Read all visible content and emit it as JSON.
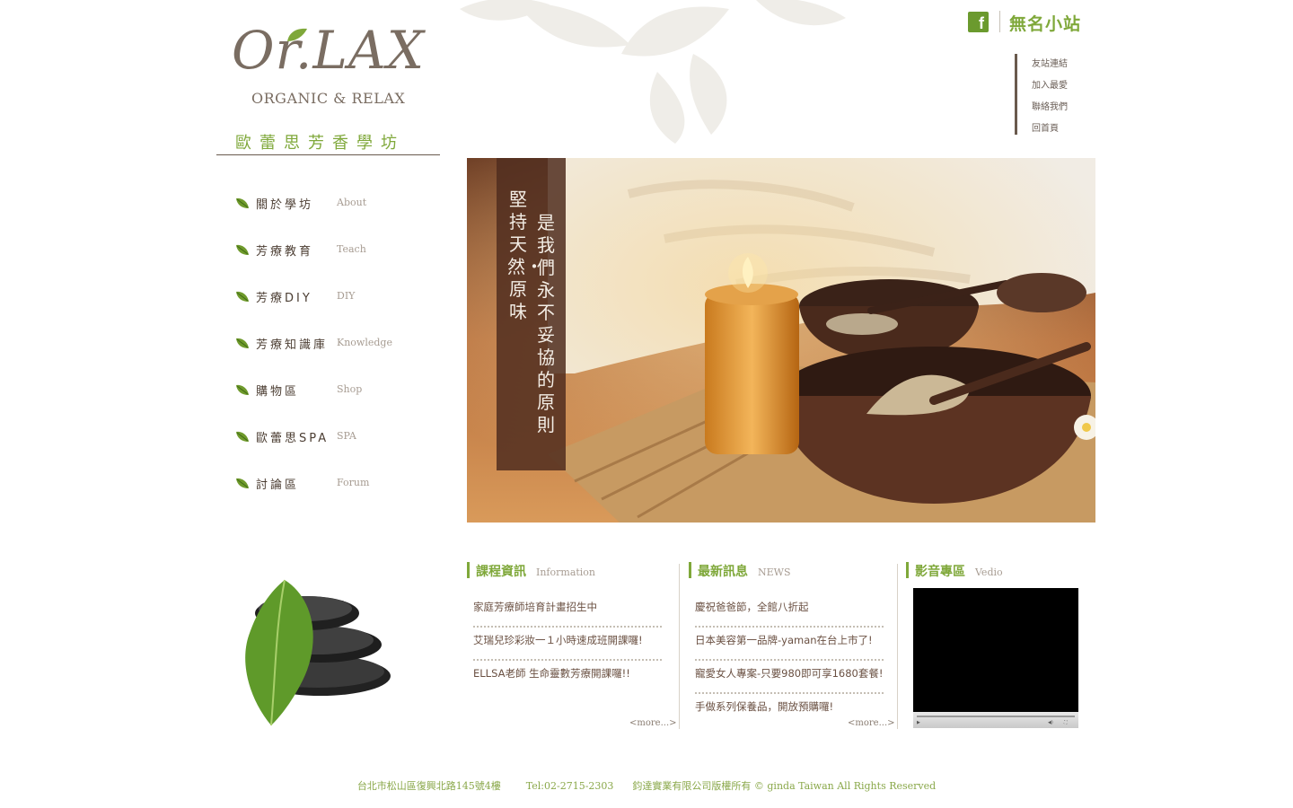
{
  "header": {
    "site_name": "無名小站",
    "facebook_icon": "facebook-icon",
    "links": [
      "友站連結",
      "加入最愛",
      "聯絡我們",
      "回首頁"
    ]
  },
  "logo": {
    "main": "Or.LAX",
    "sub": "ORGANIC & RELAX",
    "cn": "歐蕾思芳香學坊"
  },
  "nav": [
    {
      "cn": "關於學坊",
      "en": "About"
    },
    {
      "cn": "芳療教育",
      "en": "Teach"
    },
    {
      "cn": "芳療DIY",
      "en": "DIY"
    },
    {
      "cn": "芳療知識庫",
      "en": "Knowledge"
    },
    {
      "cn": "購物區",
      "en": "Shop"
    },
    {
      "cn": "歐蕾思SPA",
      "en": "SPA"
    },
    {
      "cn": "討論區",
      "en": "Forum"
    }
  ],
  "hero": {
    "line1": "堅持天然・原味",
    "line2": "是我們永不妥協的原則"
  },
  "info": {
    "title": "課程資訊",
    "subtitle": "Information",
    "items": [
      "家庭芳療師培育計畫招生中",
      "艾瑞兒珍彩妝一１小時速成班開課囉!",
      "ELLSA老師 生命靈數芳療開課囉!!"
    ],
    "more": "<more...>"
  },
  "news": {
    "title": "最新訊息",
    "subtitle": "NEWS",
    "items": [
      "慶祝爸爸節，全館八折起",
      "日本美容第一品牌-yaman在台上市了!",
      "寵愛女人專案-只要980即可享1680套餐!",
      "手做系列保養品，開放預購囉!"
    ],
    "more": "<more...>"
  },
  "video": {
    "title": "影音專區",
    "subtitle": "Vedio"
  },
  "footer": {
    "text": "台北市松山區復興北路145號4樓        Tel:02-2715-2303      鈞達實業有限公司版權所有 © ginda Taiwan All Rights Reserved"
  },
  "colors": {
    "accent_green": "#7fa83a",
    "brown": "#5a4e44",
    "hero_band": "#502d1e"
  }
}
